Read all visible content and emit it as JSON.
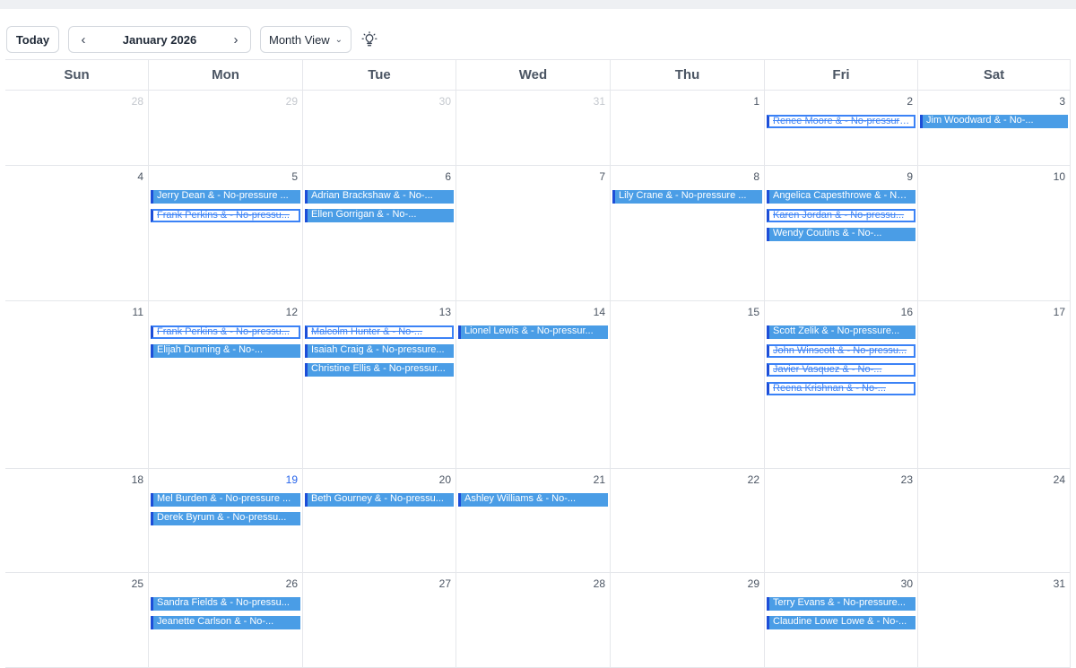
{
  "toolbar": {
    "today_label": "Today",
    "month_label": "January 2026",
    "view_label": "Month View"
  },
  "weekdays": [
    "Sun",
    "Mon",
    "Tue",
    "Wed",
    "Thu",
    "Fri",
    "Sat"
  ],
  "today": 19,
  "weeks": [
    {
      "days": [
        {
          "num": "28",
          "muted": true,
          "events": []
        },
        {
          "num": "29",
          "muted": true,
          "events": []
        },
        {
          "num": "30",
          "muted": true,
          "events": []
        },
        {
          "num": "31",
          "muted": true,
          "events": []
        },
        {
          "num": "1",
          "events": []
        },
        {
          "num": "2",
          "events": [
            {
              "text": "Renee Moore &  - No-pressure ...",
              "style": "outline"
            }
          ]
        },
        {
          "num": "3",
          "events": [
            {
              "text": "Jim Woodward &  - No-...",
              "style": "solid"
            }
          ]
        }
      ]
    },
    {
      "days": [
        {
          "num": "4",
          "events": []
        },
        {
          "num": "5",
          "events": [
            {
              "text": "Jerry Dean &  - No-pressure ...",
              "style": "solid"
            },
            {
              "text": "Frank Perkins &  - No-pressu...",
              "style": "outline"
            }
          ]
        },
        {
          "num": "6",
          "events": [
            {
              "text": "Adrian Brackshaw &  - No-...",
              "style": "solid"
            },
            {
              "text": "Ellen Gorrigan &  - No-...",
              "style": "solid"
            }
          ]
        },
        {
          "num": "7",
          "events": []
        },
        {
          "num": "8",
          "events": [
            {
              "text": "Lily Crane &  - No-pressure ...",
              "style": "solid"
            }
          ]
        },
        {
          "num": "9",
          "events": [
            {
              "text": "Angelica Capesthrowe &  - No-...",
              "style": "solid"
            },
            {
              "text": "Karen Jordan &  - No-pressu...",
              "style": "outline"
            },
            {
              "text": "Wendy Coutins &  - No-...",
              "style": "solid"
            }
          ]
        },
        {
          "num": "10",
          "events": []
        }
      ]
    },
    {
      "days": [
        {
          "num": "11",
          "events": []
        },
        {
          "num": "12",
          "events": [
            {
              "text": "Frank Perkins &  - No-pressu...",
              "style": "outline"
            },
            {
              "text": "Elijah Dunning &  - No-...",
              "style": "solid"
            }
          ]
        },
        {
          "num": "13",
          "events": [
            {
              "text": "Malcolm Hunter &  - No-...",
              "style": "outline"
            },
            {
              "text": "Isaiah Craig &  - No-pressure...",
              "style": "solid"
            },
            {
              "text": "Christine Ellis &  - No-pressur...",
              "style": "solid"
            }
          ]
        },
        {
          "num": "14",
          "events": [
            {
              "text": "Lionel Lewis &  - No-pressur...",
              "style": "solid"
            }
          ]
        },
        {
          "num": "15",
          "events": []
        },
        {
          "num": "16",
          "events": [
            {
              "text": "Scott Zelik &  - No-pressure...",
              "style": "solid"
            },
            {
              "text": "John Winscott &  - No-pressu...",
              "style": "outline"
            },
            {
              "text": "Javier Vasquez &  - No-...",
              "style": "outline"
            },
            {
              "text": "Reena Krishnan &  - No-...",
              "style": "outline"
            }
          ]
        },
        {
          "num": "17",
          "events": []
        }
      ]
    },
    {
      "days": [
        {
          "num": "18",
          "events": []
        },
        {
          "num": "19",
          "events": [
            {
              "text": "Mel Burden &  - No-pressure ...",
              "style": "solid"
            },
            {
              "text": "Derek Byrum &  - No-pressu...",
              "style": "solid"
            }
          ]
        },
        {
          "num": "20",
          "events": [
            {
              "text": "Beth Gourney &  - No-pressu...",
              "style": "solid"
            }
          ]
        },
        {
          "num": "21",
          "events": [
            {
              "text": "Ashley Williams &  - No-...",
              "style": "solid"
            }
          ]
        },
        {
          "num": "22",
          "events": []
        },
        {
          "num": "23",
          "events": []
        },
        {
          "num": "24",
          "events": []
        }
      ]
    },
    {
      "days": [
        {
          "num": "25",
          "events": []
        },
        {
          "num": "26",
          "events": [
            {
              "text": "Sandra Fields &  - No-pressu...",
              "style": "solid"
            },
            {
              "text": "Jeanette Carlson &  - No-...",
              "style": "solid"
            }
          ]
        },
        {
          "num": "27",
          "events": []
        },
        {
          "num": "28",
          "events": []
        },
        {
          "num": "29",
          "events": []
        },
        {
          "num": "30",
          "events": [
            {
              "text": "Terry Evans &  - No-pressure...",
              "style": "solid"
            },
            {
              "text": "Claudine Lowe Lowe &  - No-...",
              "style": "solid"
            }
          ]
        },
        {
          "num": "31",
          "events": []
        }
      ]
    }
  ]
}
